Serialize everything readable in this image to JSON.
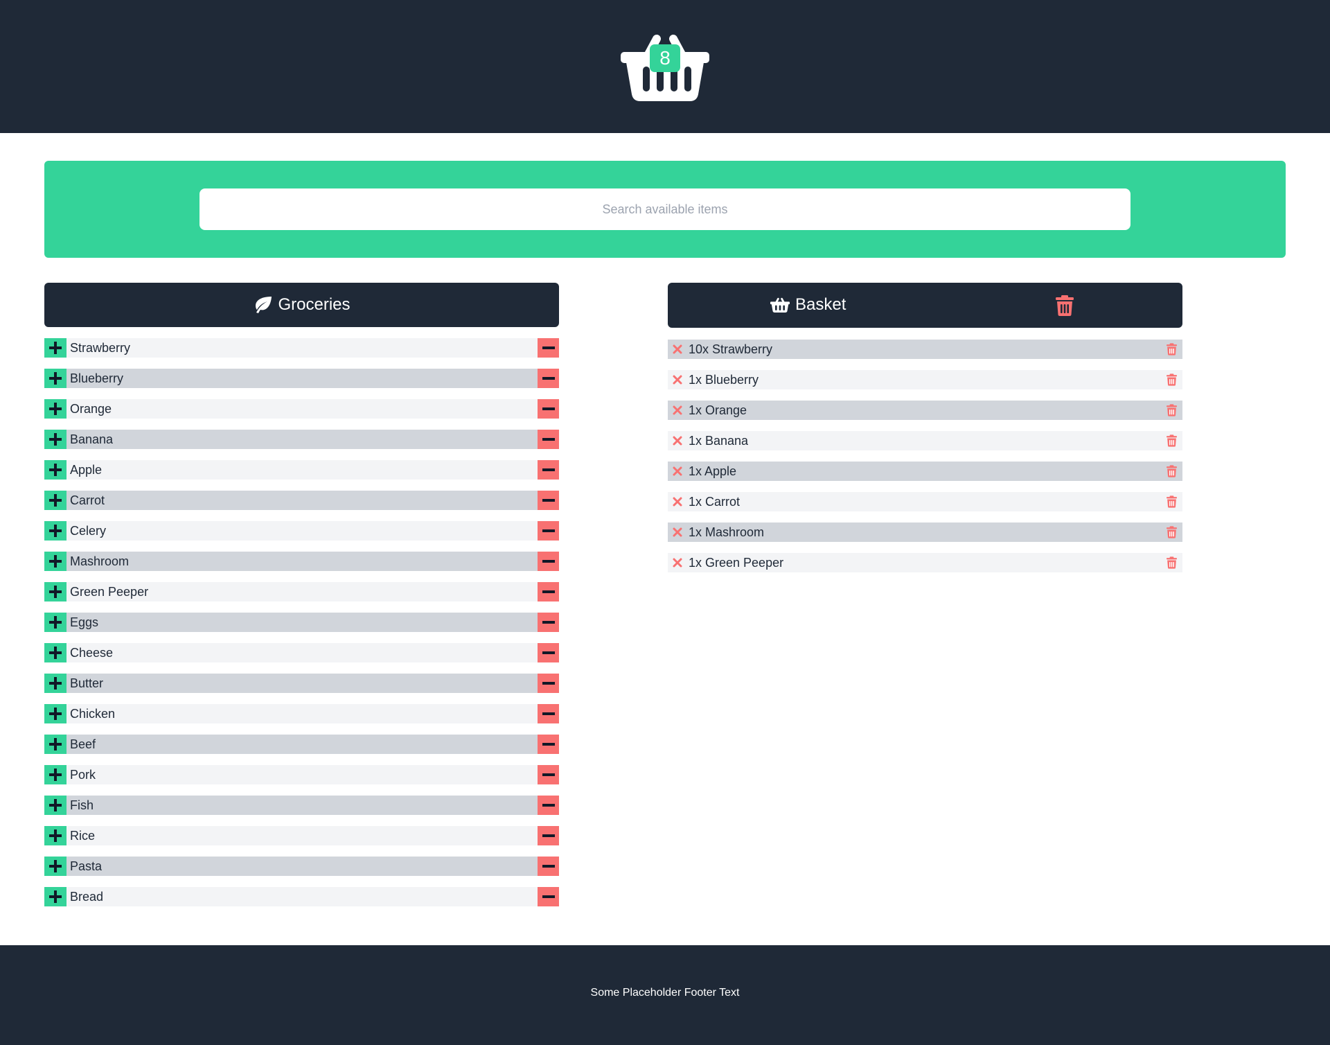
{
  "header": {
    "icon": "shopping-basket-icon",
    "basket_count": "8",
    "badge_color": "#34d399",
    "background": "#1f2937"
  },
  "search": {
    "placeholder": "Search available items",
    "value": "",
    "panel_color": "#34d399"
  },
  "groceries": {
    "icon": "leaf-icon",
    "title": "Groceries",
    "add_icon": "plus-icon",
    "remove_icon": "minus-icon",
    "items": [
      {
        "label": "Strawberry"
      },
      {
        "label": "Blueberry"
      },
      {
        "label": "Orange"
      },
      {
        "label": "Banana"
      },
      {
        "label": "Apple"
      },
      {
        "label": "Carrot"
      },
      {
        "label": "Celery"
      },
      {
        "label": "Mashroom"
      },
      {
        "label": "Green Peeper"
      },
      {
        "label": "Eggs"
      },
      {
        "label": "Cheese"
      },
      {
        "label": "Butter"
      },
      {
        "label": "Chicken"
      },
      {
        "label": "Beef"
      },
      {
        "label": "Pork"
      },
      {
        "label": "Fish"
      },
      {
        "label": "Rice"
      },
      {
        "label": "Pasta"
      },
      {
        "label": "Bread"
      }
    ]
  },
  "basket": {
    "icon": "shopping-basket-icon",
    "title": "Basket",
    "clear_icon": "trash-icon",
    "remove_icon": "x-icon",
    "delete_icon": "trash-icon",
    "items": [
      {
        "label": "10x Strawberry"
      },
      {
        "label": "1x Blueberry"
      },
      {
        "label": "1x Orange"
      },
      {
        "label": "1x Banana"
      },
      {
        "label": "1x Apple"
      },
      {
        "label": "1x Carrot"
      },
      {
        "label": "1x Mashroom"
      },
      {
        "label": "1x Green Peeper"
      }
    ]
  },
  "colors": {
    "dark": "#1f2937",
    "accent_green": "#34d399",
    "danger_red": "#f87171",
    "row_light": "#f3f4f6",
    "row_dark": "#d1d5db"
  },
  "footer": {
    "text": "Some Placeholder Footer Text"
  }
}
